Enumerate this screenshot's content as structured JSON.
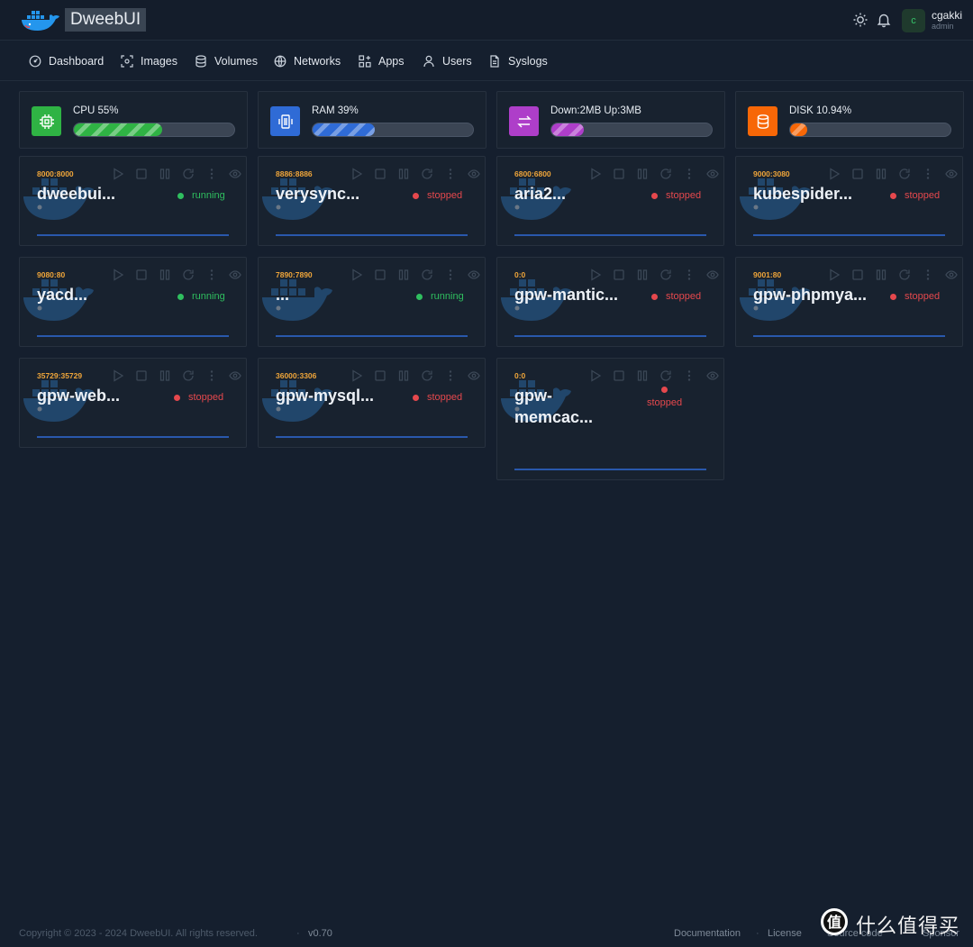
{
  "app": {
    "brand": "DweebUI"
  },
  "header": {
    "user_initial": "c",
    "username": "cgakki",
    "role": "admin"
  },
  "nav": [
    {
      "label": "Dashboard",
      "icon": "dashboard-icon"
    },
    {
      "label": "Images",
      "icon": "image-icon"
    },
    {
      "label": "Volumes",
      "icon": "database-icon"
    },
    {
      "label": "Networks",
      "icon": "globe-icon"
    },
    {
      "label": "Apps",
      "icon": "apps-grid-icon"
    },
    {
      "label": "Users",
      "icon": "user-icon"
    },
    {
      "label": "Syslogs",
      "icon": "file-icon"
    }
  ],
  "stats": [
    {
      "label": "CPU 55%",
      "value": 0.55,
      "color": "#2fb344",
      "icon": "cpu-icon"
    },
    {
      "label": "RAM 39%",
      "value": 0.39,
      "color": "#2f6bd6",
      "icon": "memory-icon"
    },
    {
      "label": "Down:2MB Up:3MB",
      "value": 0.2,
      "color": "#ae3ec9",
      "icon": "transfer-icon"
    },
    {
      "label": "DISK 10.94%",
      "value": 0.1094,
      "color": "#f76707",
      "icon": "disk-icon"
    }
  ],
  "containers": [
    {
      "port": "8000:8000",
      "name": "dweebui...",
      "status": "running"
    },
    {
      "port": "8886:8886",
      "name": "verysync...",
      "status": "stopped"
    },
    {
      "port": "6800:6800",
      "name": "aria2...",
      "status": "stopped"
    },
    {
      "port": "9000:3080",
      "name": "kubespider...",
      "status": "stopped"
    },
    {
      "port": "9080:80",
      "name": "yacd...",
      "status": "running"
    },
    {
      "port": "7890:7890",
      "name": "...",
      "status": "running"
    },
    {
      "port": "0:0",
      "name": "gpw-mantic...",
      "status": "stopped"
    },
    {
      "port": "9001:80",
      "name": "gpw-phpmya...",
      "status": "stopped"
    },
    {
      "port": "35729:35729",
      "name": "gpw-web...",
      "status": "stopped"
    },
    {
      "port": "36000:3306",
      "name": "gpw-mysql...",
      "status": "stopped"
    },
    {
      "port": "0:0",
      "name": "gpw-memcac...",
      "status": "stopped"
    }
  ],
  "footer": {
    "copyright": "Copyright © 2023 - 2024 DweebUI. All rights reserved.",
    "version": "v0.70",
    "links": [
      "Documentation",
      "License",
      "Source code",
      "Sponsor"
    ],
    "watermark": "什么值得买"
  },
  "colors": {
    "accent_running": "#2fbf5f",
    "accent_stopped": "#e5484d",
    "port": "#f0a63a",
    "background": "#151f2e"
  }
}
